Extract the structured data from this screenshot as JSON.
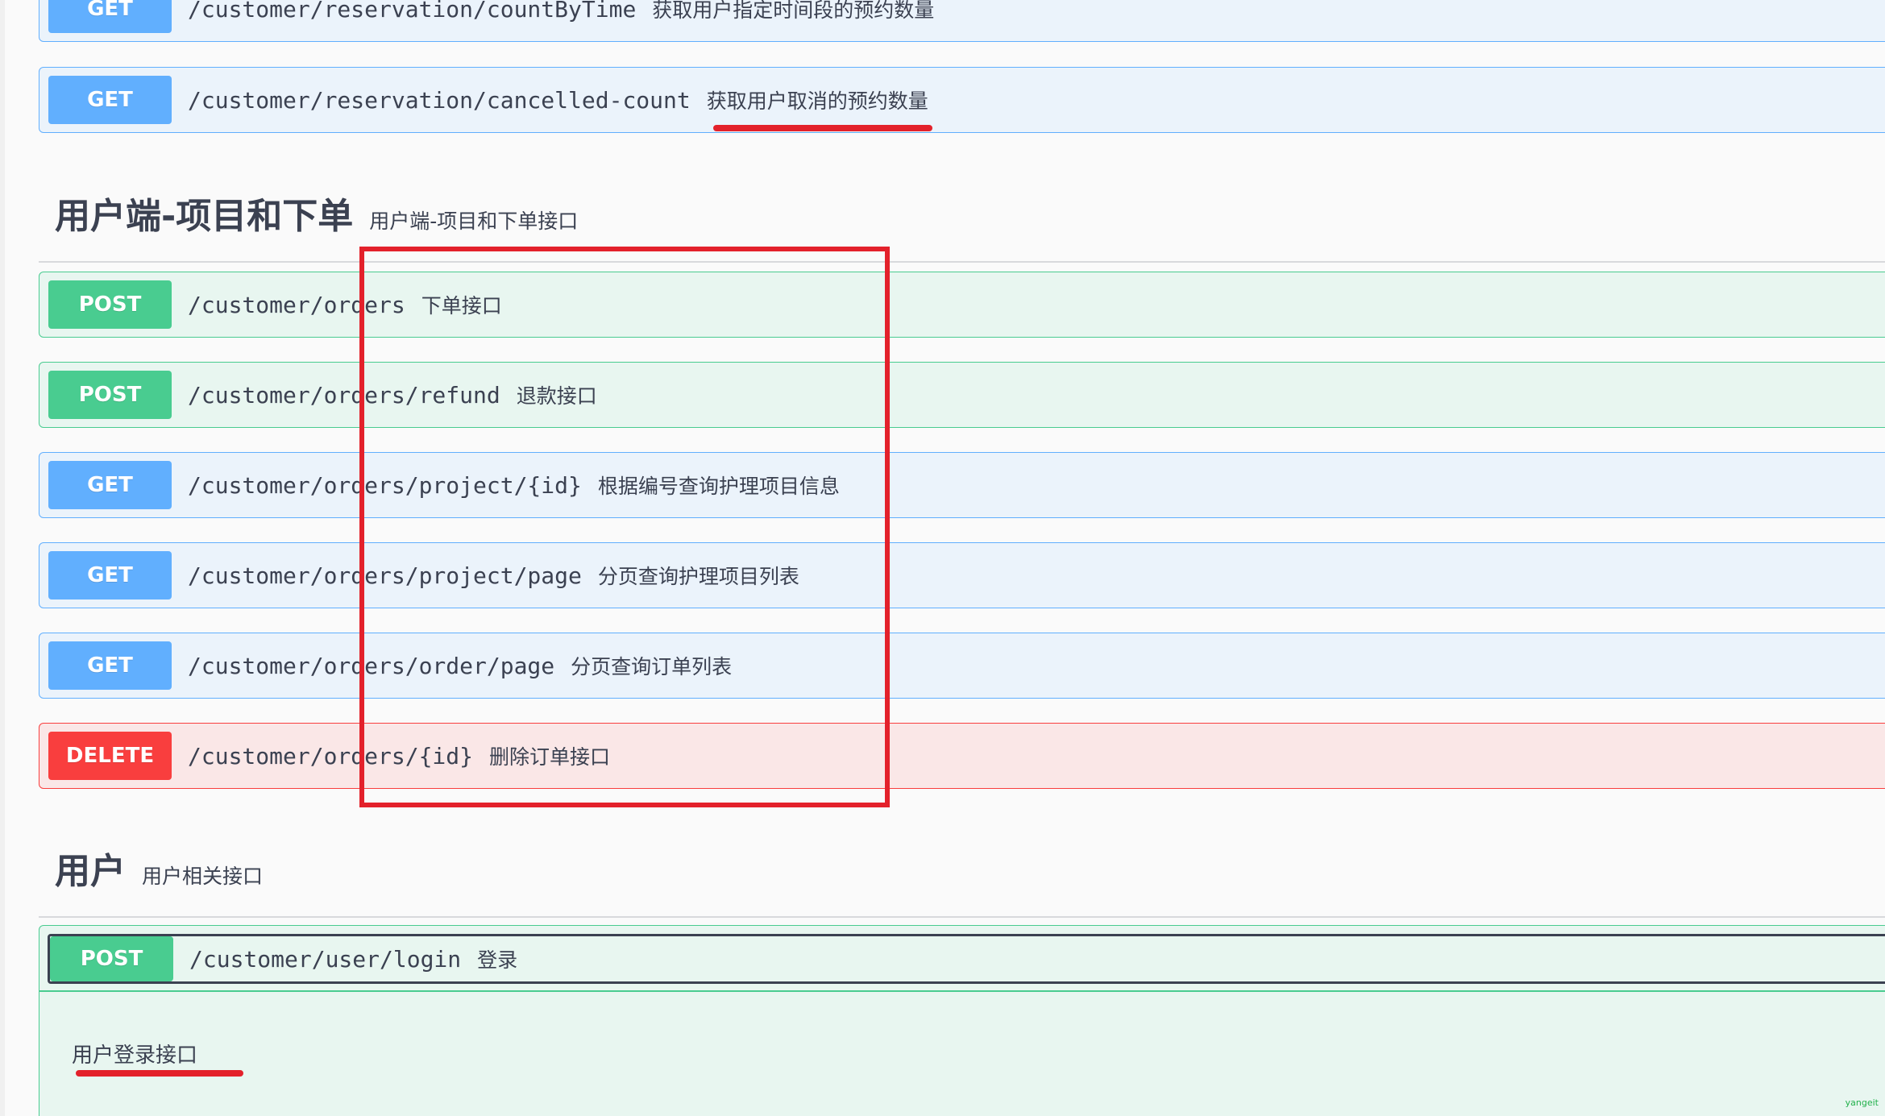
{
  "top_partial": {
    "method": "GET",
    "path": "/customer/reservation/countByTime",
    "summary": "获取用户指定时间段的预约数量"
  },
  "reservation_ops": [
    {
      "method": "GET",
      "path": "/customer/reservation/cancelled-count",
      "summary": "获取用户取消的预约数量"
    }
  ],
  "section_orders": {
    "name": "用户端-项目和下单",
    "description": "用户端-项目和下单接口",
    "operations": [
      {
        "method": "POST",
        "path": "/customer/orders",
        "summary": "下单接口"
      },
      {
        "method": "POST",
        "path": "/customer/orders/refund",
        "summary": "退款接口"
      },
      {
        "method": "GET",
        "path": "/customer/orders/project/{id}",
        "summary": "根据编号查询护理项目信息"
      },
      {
        "method": "GET",
        "path": "/customer/orders/project/page",
        "summary": "分页查询护理项目列表"
      },
      {
        "method": "GET",
        "path": "/customer/orders/order/page",
        "summary": "分页查询订单列表"
      },
      {
        "method": "DELETE",
        "path": "/customer/orders/{id}",
        "summary": "删除订单接口"
      }
    ]
  },
  "section_user": {
    "name": "用户",
    "description": "用户相关接口",
    "operations": [
      {
        "method": "POST",
        "path": "/customer/user/login",
        "summary": "登录",
        "expanded_description": "用户登录接口"
      }
    ]
  },
  "watermark": "yangeit",
  "colors": {
    "get": "#61affe",
    "post": "#49cc90",
    "delete": "#f93e3e",
    "annotation_red": "#e3212b"
  }
}
